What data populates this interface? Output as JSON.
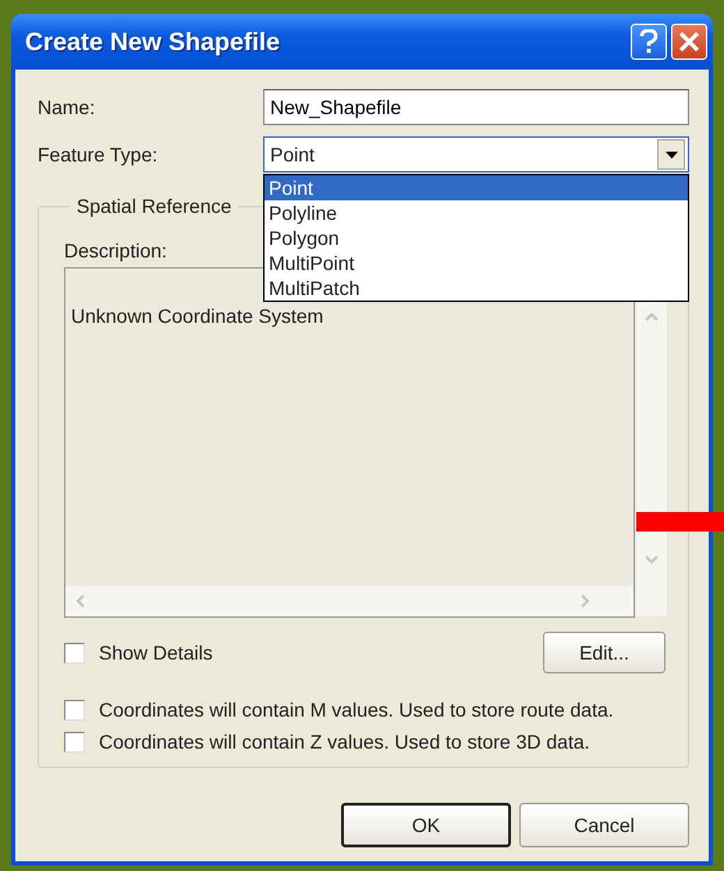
{
  "window": {
    "title": "Create New Shapefile"
  },
  "name_field": {
    "label": "Name:",
    "value": "New_Shapefile"
  },
  "feature_type": {
    "label": "Feature Type:",
    "value": "Point",
    "expanded": true,
    "options": [
      {
        "label": "Point",
        "selected": true
      },
      {
        "label": "Polyline",
        "selected": false
      },
      {
        "label": "Polygon",
        "selected": false
      },
      {
        "label": "MultiPoint",
        "selected": false
      },
      {
        "label": "MultiPatch",
        "selected": false
      }
    ]
  },
  "spatial_reference": {
    "title": "Spatial Reference",
    "description_label": "Description:",
    "description": "Unknown Coordinate System",
    "show_details": {
      "label": "Show Details",
      "checked": false
    },
    "edit_button": "Edit..."
  },
  "options": [
    {
      "label": "Coordinates will contain M values. Used to store route data.",
      "checked": false
    },
    {
      "label": "Coordinates will contain Z values. Used to store 3D data.",
      "checked": false
    }
  ],
  "buttons": [
    {
      "label": "OK",
      "default": true
    },
    {
      "label": "Cancel",
      "default": false
    }
  ]
}
